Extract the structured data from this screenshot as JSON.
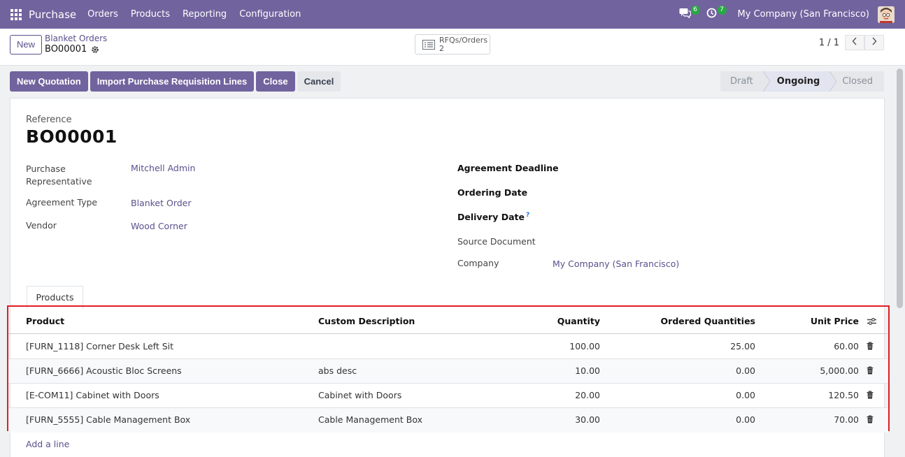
{
  "navbar": {
    "brand": "Purchase",
    "menu": [
      "Orders",
      "Products",
      "Reporting",
      "Configuration"
    ],
    "messages_count": "6",
    "activities_count": "7",
    "company": "My Company (San Francisco)"
  },
  "control_panel": {
    "new_label": "New",
    "breadcrumb_parent": "Blanket Orders",
    "breadcrumb_current": "BO00001",
    "smart_button": {
      "label": "RFQs/Orders",
      "count": "2"
    },
    "pager": "1 / 1"
  },
  "actions": {
    "new_quotation": "New Quotation",
    "import_lines": "Import Purchase Requisition Lines",
    "close": "Close",
    "cancel": "Cancel"
  },
  "statusbar": {
    "stages": [
      "Draft",
      "Ongoing",
      "Closed"
    ],
    "active": "Ongoing"
  },
  "form": {
    "reference_label": "Reference",
    "reference": "BO00001",
    "left_fields": [
      {
        "label_line1": "Purchase",
        "label_line2": "Representative",
        "value": "Mitchell Admin"
      },
      {
        "label": "Agreement Type",
        "value": "Blanket Order"
      },
      {
        "label": "Vendor",
        "value": "Wood Corner"
      }
    ],
    "right_fields": [
      {
        "label": "Agreement Deadline",
        "value": ""
      },
      {
        "label": "Ordering Date",
        "value": ""
      },
      {
        "label": "Delivery Date",
        "help": "?",
        "value": ""
      },
      {
        "label": "Source Document",
        "value": ""
      },
      {
        "label": "Company",
        "value": "My Company (San Francisco)"
      }
    ],
    "tab": "Products"
  },
  "table": {
    "headers": [
      "Product",
      "Custom Description",
      "Quantity",
      "Ordered Quantities",
      "Unit Price"
    ],
    "rows": [
      {
        "product": "[FURN_1118] Corner Desk Left Sit",
        "description": "",
        "quantity": "100.00",
        "ordered": "25.00",
        "price": "60.00"
      },
      {
        "product": "[FURN_6666] Acoustic Bloc Screens",
        "description": "abs desc",
        "quantity": "10.00",
        "ordered": "0.00",
        "price": "5,000.00"
      },
      {
        "product": "[E-COM11] Cabinet with Doors",
        "description": "Cabinet with Doors",
        "quantity": "20.00",
        "ordered": "0.00",
        "price": "120.50"
      },
      {
        "product": "[FURN_5555] Cable Management Box",
        "description": "Cable Management Box",
        "quantity": "30.00",
        "ordered": "0.00",
        "price": "70.00"
      }
    ],
    "add_line": "Add a line"
  },
  "colors": {
    "navbar": "#71639e",
    "primary": "#71639e",
    "link": "#5b4f8c",
    "highlight_border": "#e01e26",
    "badge": "#28a745"
  },
  "icons": [
    "apps-grid-icon",
    "chat-icon",
    "activity-clock-icon",
    "gear-icon",
    "list-icon",
    "chevron-left-icon",
    "chevron-right-icon",
    "trash-icon",
    "column-options-icon"
  ]
}
